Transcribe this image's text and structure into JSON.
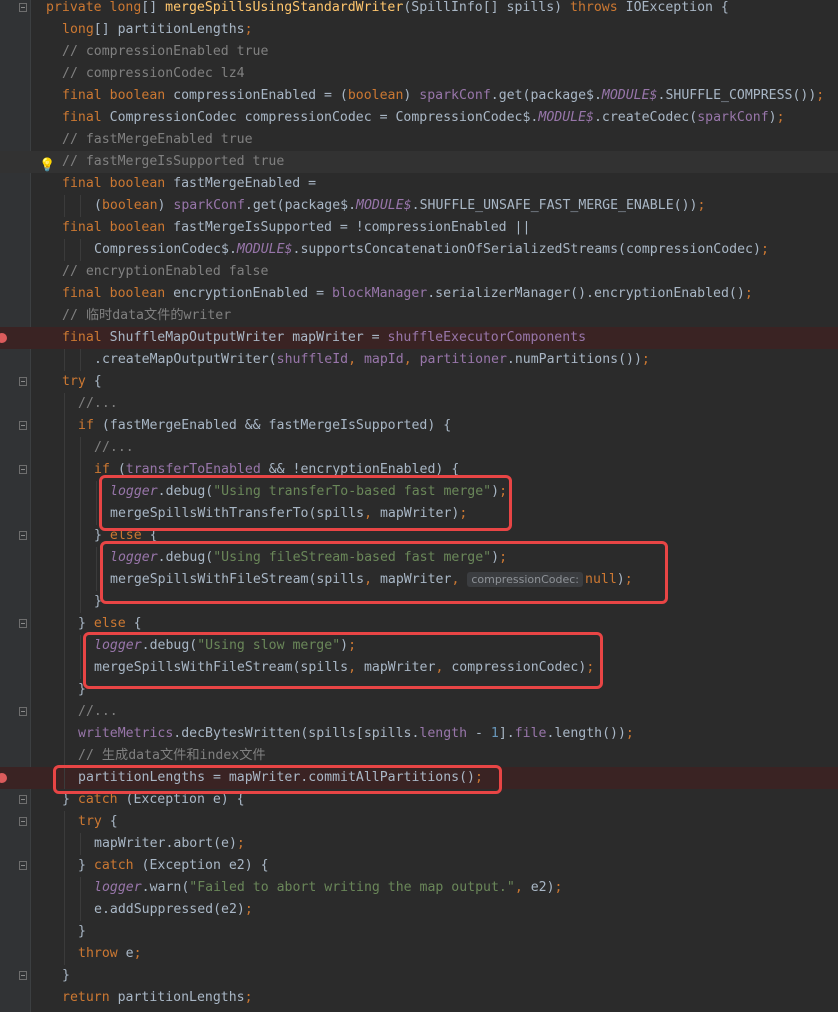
{
  "editor": {
    "lines": [
      {
        "indent": 0,
        "tokens": [
          [
            "k",
            "private "
          ],
          [
            "k",
            "long"
          ],
          [
            "p",
            "[] "
          ],
          [
            "m",
            "mergeSpillsUsingStandardWriter"
          ],
          [
            "p",
            "(SpillInfo[] spills) "
          ],
          [
            "k",
            "throws "
          ],
          [
            "p",
            "IOException {"
          ]
        ]
      },
      {
        "indent": 1,
        "tokens": [
          [
            "k",
            "long"
          ],
          [
            "p",
            "[] partitionLengths"
          ],
          [
            "k",
            ";"
          ]
        ]
      },
      {
        "indent": 1,
        "tokens": [
          [
            "c",
            "// compressionEnabled true"
          ]
        ]
      },
      {
        "indent": 1,
        "tokens": [
          [
            "c",
            "// compressionCodec lz4"
          ]
        ]
      },
      {
        "indent": 1,
        "tokens": [
          [
            "k",
            "final boolean "
          ],
          [
            "p",
            "compressionEnabled = ("
          ],
          [
            "k",
            "boolean"
          ],
          [
            "p",
            ") "
          ],
          [
            "f",
            "sparkConf"
          ],
          [
            "p",
            ".get(package$."
          ],
          [
            "fi",
            "MODULE$"
          ],
          [
            "p",
            ".SHUFFLE_COMPRESS())"
          ],
          [
            "k",
            ";"
          ]
        ]
      },
      {
        "indent": 1,
        "tokens": [
          [
            "k",
            "final "
          ],
          [
            "p",
            "CompressionCodec compressionCodec = CompressionCodec$."
          ],
          [
            "fi",
            "MODULE$"
          ],
          [
            "p",
            ".createCodec("
          ],
          [
            "f",
            "sparkConf"
          ],
          [
            "p",
            ")"
          ],
          [
            "k",
            ";"
          ]
        ]
      },
      {
        "indent": 1,
        "tokens": [
          [
            "c",
            "// fastMergeEnabled true"
          ]
        ]
      },
      {
        "indent": 1,
        "tokens": [
          [
            "c",
            "// fastMergeIsSupported true"
          ]
        ]
      },
      {
        "indent": 1,
        "tokens": [
          [
            "k",
            "final boolean "
          ],
          [
            "p",
            "fastMergeEnabled ="
          ]
        ]
      },
      {
        "indent": 3,
        "tokens": [
          [
            "p",
            "("
          ],
          [
            "k",
            "boolean"
          ],
          [
            "p",
            ") "
          ],
          [
            "f",
            "sparkConf"
          ],
          [
            "p",
            ".get(package$."
          ],
          [
            "fi",
            "MODULE$"
          ],
          [
            "p",
            ".SHUFFLE_UNSAFE_FAST_MERGE_ENABLE())"
          ],
          [
            "k",
            ";"
          ]
        ]
      },
      {
        "indent": 1,
        "tokens": [
          [
            "k",
            "final boolean "
          ],
          [
            "p",
            "fastMergeIsSupported = !compressionEnabled ||"
          ]
        ]
      },
      {
        "indent": 3,
        "tokens": [
          [
            "p",
            "CompressionCodec$."
          ],
          [
            "fi",
            "MODULE$"
          ],
          [
            "p",
            ".supportsConcatenationOfSerializedStreams(compressionCodec)"
          ],
          [
            "k",
            ";"
          ]
        ]
      },
      {
        "indent": 1,
        "tokens": [
          [
            "c",
            "// encryptionEnabled false"
          ]
        ]
      },
      {
        "indent": 1,
        "tokens": [
          [
            "k",
            "final boolean "
          ],
          [
            "p",
            "encryptionEnabled = "
          ],
          [
            "f",
            "blockManager"
          ],
          [
            "p",
            ".serializerManager().encryptionEnabled()"
          ],
          [
            "k",
            ";"
          ]
        ]
      },
      {
        "indent": 1,
        "tokens": [
          [
            "c",
            "// 临时data文件的writer"
          ]
        ]
      },
      {
        "indent": 1,
        "tokens": [
          [
            "k",
            "final "
          ],
          [
            "p",
            "ShuffleMapOutputWriter mapWriter = "
          ],
          [
            "f",
            "shuffleExecutorComponents"
          ]
        ]
      },
      {
        "indent": 3,
        "tokens": [
          [
            "p",
            ".createMapOutputWriter("
          ],
          [
            "f",
            "shuffleId"
          ],
          [
            "k",
            ", "
          ],
          [
            "f",
            "mapId"
          ],
          [
            "k",
            ", "
          ],
          [
            "f",
            "partitioner"
          ],
          [
            "p",
            ".numPartitions())"
          ],
          [
            "k",
            ";"
          ]
        ]
      },
      {
        "indent": 1,
        "tokens": [
          [
            "k",
            "try "
          ],
          [
            "p",
            "{"
          ]
        ]
      },
      {
        "indent": 2,
        "tokens": [
          [
            "c",
            "//..."
          ]
        ]
      },
      {
        "indent": 2,
        "tokens": [
          [
            "k",
            "if "
          ],
          [
            "p",
            "(fastMergeEnabled && fastMergeIsSupported) {"
          ]
        ]
      },
      {
        "indent": 3,
        "tokens": [
          [
            "c",
            "//..."
          ]
        ]
      },
      {
        "indent": 3,
        "tokens": [
          [
            "k",
            "if "
          ],
          [
            "p",
            "("
          ],
          [
            "f",
            "transferToEnabled"
          ],
          [
            "p",
            " && !encryptionEnabled) {"
          ]
        ]
      },
      {
        "indent": 4,
        "tokens": [
          [
            "fi",
            "logger"
          ],
          [
            "p",
            ".debug("
          ],
          [
            "s",
            "\"Using transferTo-based fast merge\""
          ],
          [
            "p",
            ")"
          ],
          [
            "k",
            ";"
          ]
        ]
      },
      {
        "indent": 4,
        "tokens": [
          [
            "p",
            "mergeSpillsWithTransferTo(spills"
          ],
          [
            "k",
            ", "
          ],
          [
            "p",
            "mapWriter)"
          ],
          [
            "k",
            ";"
          ]
        ]
      },
      {
        "indent": 3,
        "tokens": [
          [
            "p",
            "} "
          ],
          [
            "k",
            "else "
          ],
          [
            "p",
            "{"
          ]
        ]
      },
      {
        "indent": 4,
        "tokens": [
          [
            "fi",
            "logger"
          ],
          [
            "p",
            ".debug("
          ],
          [
            "s",
            "\"Using fileStream-based fast merge\""
          ],
          [
            "p",
            ")"
          ],
          [
            "k",
            ";"
          ]
        ]
      },
      {
        "indent": 4,
        "tokens": [
          [
            "p",
            "mergeSpillsWithFileStream(spills"
          ],
          [
            "k",
            ", "
          ],
          [
            "p",
            "mapWriter"
          ],
          [
            "k",
            ", "
          ],
          [
            "h",
            "compressionCodec:"
          ],
          [
            "k",
            "null"
          ],
          [
            "p",
            ")"
          ],
          [
            "k",
            ";"
          ]
        ]
      },
      {
        "indent": 3,
        "tokens": [
          [
            "p",
            "}"
          ]
        ]
      },
      {
        "indent": 2,
        "tokens": [
          [
            "p",
            "} "
          ],
          [
            "k",
            "else "
          ],
          [
            "p",
            "{"
          ]
        ]
      },
      {
        "indent": 3,
        "tokens": [
          [
            "fi",
            "logger"
          ],
          [
            "p",
            ".debug("
          ],
          [
            "s",
            "\"Using slow merge\""
          ],
          [
            "p",
            ")"
          ],
          [
            "k",
            ";"
          ]
        ]
      },
      {
        "indent": 3,
        "tokens": [
          [
            "p",
            "mergeSpillsWithFileStream(spills"
          ],
          [
            "k",
            ", "
          ],
          [
            "p",
            "mapWriter"
          ],
          [
            "k",
            ", "
          ],
          [
            "p",
            "compressionCodec)"
          ],
          [
            "k",
            ";"
          ]
        ]
      },
      {
        "indent": 2,
        "tokens": [
          [
            "p",
            "}"
          ]
        ]
      },
      {
        "indent": 2,
        "tokens": [
          [
            "c",
            "//..."
          ]
        ]
      },
      {
        "indent": 2,
        "tokens": [
          [
            "f",
            "writeMetrics"
          ],
          [
            "p",
            ".decBytesWritten(spills[spills."
          ],
          [
            "f",
            "length "
          ],
          [
            "p",
            "- "
          ],
          [
            "n",
            "1"
          ],
          [
            "p",
            "]."
          ],
          [
            "f",
            "file"
          ],
          [
            "p",
            ".length())"
          ],
          [
            "k",
            ";"
          ]
        ]
      },
      {
        "indent": 2,
        "tokens": [
          [
            "c",
            "// 生成data文件和index文件"
          ]
        ]
      },
      {
        "indent": 2,
        "tokens": [
          [
            "p",
            "partitionLengths = mapWriter.commitAllPartitions()"
          ],
          [
            "k",
            ";"
          ]
        ]
      },
      {
        "indent": 1,
        "tokens": [
          [
            "p",
            "} "
          ],
          [
            "k",
            "catch "
          ],
          [
            "p",
            "(Exception e) {"
          ]
        ]
      },
      {
        "indent": 2,
        "tokens": [
          [
            "k",
            "try "
          ],
          [
            "p",
            "{"
          ]
        ]
      },
      {
        "indent": 3,
        "tokens": [
          [
            "p",
            "mapWriter.abort(e)"
          ],
          [
            "k",
            ";"
          ]
        ]
      },
      {
        "indent": 2,
        "tokens": [
          [
            "p",
            "} "
          ],
          [
            "k",
            "catch "
          ],
          [
            "p",
            "(Exception e2) {"
          ]
        ]
      },
      {
        "indent": 3,
        "tokens": [
          [
            "fi",
            "logger"
          ],
          [
            "p",
            ".warn("
          ],
          [
            "s",
            "\"Failed to abort writing the map output.\""
          ],
          [
            "k",
            ", "
          ],
          [
            "p",
            "e2)"
          ],
          [
            "k",
            ";"
          ]
        ]
      },
      {
        "indent": 3,
        "tokens": [
          [
            "p",
            "e.addSuppressed(e2)"
          ],
          [
            "k",
            ";"
          ]
        ]
      },
      {
        "indent": 2,
        "tokens": [
          [
            "p",
            "}"
          ]
        ]
      },
      {
        "indent": 2,
        "tokens": [
          [
            "k",
            "throw "
          ],
          [
            "p",
            "e"
          ],
          [
            "k",
            ";"
          ]
        ]
      },
      {
        "indent": 1,
        "tokens": [
          [
            "p",
            "}"
          ]
        ]
      },
      {
        "indent": 1,
        "tokens": [
          [
            "k",
            "return "
          ],
          [
            "p",
            "partitionLengths"
          ],
          [
            "k",
            ";"
          ]
        ]
      }
    ]
  },
  "colors": {
    "background": "#2b2b2b",
    "keyword": "#cc7832",
    "comment": "#808080",
    "string": "#6a8759",
    "field": "#9876aa",
    "method": "#ffc66d",
    "number": "#6897bb",
    "highlight_box": "#e84545",
    "breakpoint": "#db5c5c"
  },
  "icons": {
    "breakpoint": "breakpoint-icon",
    "fold": "fold-icon",
    "intention": "lightbulb-icon"
  }
}
